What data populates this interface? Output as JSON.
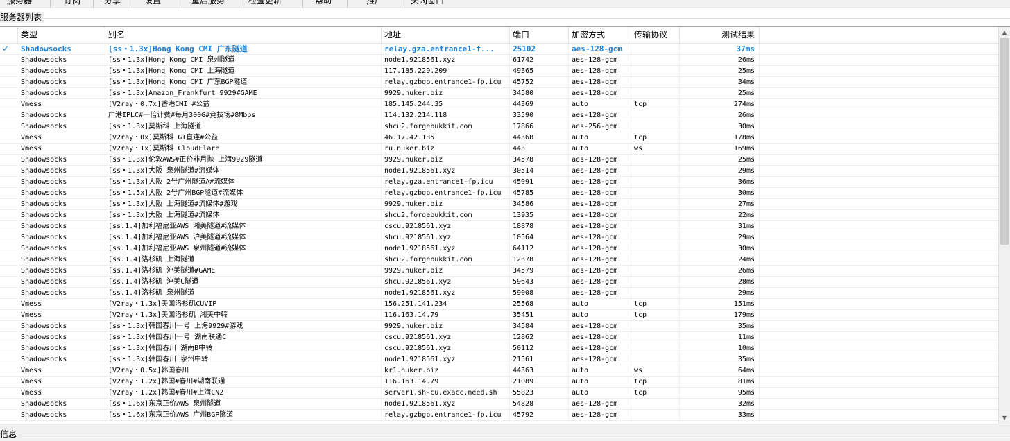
{
  "menu": {
    "items": [
      "服务器",
      "订阅",
      "分享",
      "设置",
      "重启服务",
      "检查更新",
      "帮助",
      "推广",
      "关闭窗口"
    ]
  },
  "server_list": {
    "title": "服务器列表",
    "columns": {
      "type": "类型",
      "alias": "别名",
      "address": "地址",
      "port": "端口",
      "encryption": "加密方式",
      "protocol": "传输协议",
      "test_result": "测试结果"
    },
    "active_marker": "✓",
    "rows": [
      {
        "type": "Shadowsocks",
        "alias": "[ss・1.3x]Hong Kong CMI 广东隧道",
        "address": "relay.gza.entrance1-f...",
        "port": "25102",
        "encryption": "aes-128-gcm",
        "protocol": "",
        "result": "37ms",
        "active": true
      },
      {
        "type": "Shadowsocks",
        "alias": "[ss・1.3x]Hong Kong CMI 泉州隧道",
        "address": "node1.9218561.xyz",
        "port": "61742",
        "encryption": "aes-128-gcm",
        "protocol": "",
        "result": "26ms"
      },
      {
        "type": "Shadowsocks",
        "alias": "[ss・1.3x]Hong Kong CMI 上海隧道",
        "address": "117.185.229.209",
        "port": "49365",
        "encryption": "aes-128-gcm",
        "protocol": "",
        "result": "25ms"
      },
      {
        "type": "Shadowsocks",
        "alias": "[ss・1.3x]Hong Kong CMI 广东BGP隧道",
        "address": "relay.gzbgp.entrance1-fp.icu",
        "port": "45752",
        "encryption": "aes-128-gcm",
        "protocol": "",
        "result": "34ms"
      },
      {
        "type": "Shadowsocks",
        "alias": "[ss・1.3x]Amazon_Frankfurt 9929#GAME",
        "address": "9929.nuker.biz",
        "port": "34580",
        "encryption": "aes-128-gcm",
        "protocol": "",
        "result": "25ms"
      },
      {
        "type": "Vmess",
        "alias": "[V2ray・0.7x]香港CMI #公益",
        "address": "185.145.244.35",
        "port": "44369",
        "encryption": "auto",
        "protocol": "tcp",
        "result": "274ms"
      },
      {
        "type": "Shadowsocks",
        "alias": "广港IPLC#一倍计费#每月300G#竞技场#8Mbps",
        "address": "114.132.214.118",
        "port": "33590",
        "encryption": "aes-128-gcm",
        "protocol": "",
        "result": "26ms"
      },
      {
        "type": "Shadowsocks",
        "alias": "[ss・1.3x]莫斯科 上海隧道",
        "address": "shcu2.forgebukkit.com",
        "port": "17866",
        "encryption": "aes-256-gcm",
        "protocol": "",
        "result": "30ms"
      },
      {
        "type": "Vmess",
        "alias": "[V2ray・0x]莫斯科 GT直连#公益",
        "address": "46.17.42.135",
        "port": "44368",
        "encryption": "auto",
        "protocol": "tcp",
        "result": "178ms"
      },
      {
        "type": "Vmess",
        "alias": "[V2ray・1x]莫斯科 CloudFlare",
        "address": "ru.nuker.biz",
        "port": "443",
        "encryption": "auto",
        "protocol": "ws",
        "result": "169ms"
      },
      {
        "type": "Shadowsocks",
        "alias": "[ss・1.3x]伦敦AWS#正价非月抛 上海9929隧道",
        "address": "9929.nuker.biz",
        "port": "34578",
        "encryption": "aes-128-gcm",
        "protocol": "",
        "result": "25ms"
      },
      {
        "type": "Shadowsocks",
        "alias": "[ss・1.3x]大阪 泉州隧道#流媒体",
        "address": "node1.9218561.xyz",
        "port": "30514",
        "encryption": "aes-128-gcm",
        "protocol": "",
        "result": "29ms"
      },
      {
        "type": "Shadowsocks",
        "alias": "[ss・1.3x]大阪 2号广州隧道A#流媒体",
        "address": "relay.gza.entrance1-fp.icu",
        "port": "45091",
        "encryption": "aes-128-gcm",
        "protocol": "",
        "result": "36ms"
      },
      {
        "type": "Shadowsocks",
        "alias": "[ss・1.5x]大阪 2号广州BGP隧道#流媒体",
        "address": "relay.gzbgp.entrance1-fp.icu",
        "port": "45785",
        "encryption": "aes-128-gcm",
        "protocol": "",
        "result": "30ms"
      },
      {
        "type": "Shadowsocks",
        "alias": "[ss・1.3x]大阪 上海隧道#流媒体#游戏",
        "address": "9929.nuker.biz",
        "port": "34586",
        "encryption": "aes-128-gcm",
        "protocol": "",
        "result": "27ms"
      },
      {
        "type": "Shadowsocks",
        "alias": "[ss・1.3x]大阪 上海隧道#流媒体",
        "address": "shcu2.forgebukkit.com",
        "port": "13935",
        "encryption": "aes-128-gcm",
        "protocol": "",
        "result": "22ms"
      },
      {
        "type": "Shadowsocks",
        "alias": "[ss.1.4]加利福尼亚AWS 湘美隧道#流媒体",
        "address": "cscu.9218561.xyz",
        "port": "18878",
        "encryption": "aes-128-gcm",
        "protocol": "",
        "result": "31ms"
      },
      {
        "type": "Shadowsocks",
        "alias": "[ss.1.4]加利福尼亚AWS 沪美隧道#流媒体",
        "address": "shcu.9218561.xyz",
        "port": "10564",
        "encryption": "aes-128-gcm",
        "protocol": "",
        "result": "29ms"
      },
      {
        "type": "Shadowsocks",
        "alias": "[ss.1.4]加利福尼亚AWS 泉州隧道#流媒体",
        "address": "node1.9218561.xyz",
        "port": "64112",
        "encryption": "aes-128-gcm",
        "protocol": "",
        "result": "30ms"
      },
      {
        "type": "Shadowsocks",
        "alias": "[ss.1.4]洛杉矶 上海隧道",
        "address": "shcu2.forgebukkit.com",
        "port": "12378",
        "encryption": "aes-128-gcm",
        "protocol": "",
        "result": "24ms"
      },
      {
        "type": "Shadowsocks",
        "alias": "[ss.1.4]洛杉矶 沪美隧道#GAME",
        "address": "9929.nuker.biz",
        "port": "34579",
        "encryption": "aes-128-gcm",
        "protocol": "",
        "result": "26ms"
      },
      {
        "type": "Shadowsocks",
        "alias": "[ss.1.4]洛杉矶 沪美C隧道",
        "address": "shcu.9218561.xyz",
        "port": "59643",
        "encryption": "aes-128-gcm",
        "protocol": "",
        "result": "28ms"
      },
      {
        "type": "Shadowsocks",
        "alias": "[ss.1.4]洛杉矶 泉州隧道",
        "address": "node1.9218561.xyz",
        "port": "59008",
        "encryption": "aes-128-gcm",
        "protocol": "",
        "result": "29ms"
      },
      {
        "type": "Vmess",
        "alias": "[V2ray・1.3x]美国洛杉矶CUVIP",
        "address": "156.251.141.234",
        "port": "25568",
        "encryption": "auto",
        "protocol": "tcp",
        "result": "151ms"
      },
      {
        "type": "Vmess",
        "alias": "[V2ray・1.3x]美国洛杉矶 湘美中转",
        "address": "116.163.14.79",
        "port": "35451",
        "encryption": "auto",
        "protocol": "tcp",
        "result": "179ms"
      },
      {
        "type": "Shadowsocks",
        "alias": "[ss・1.3x]韩国春川一号 上海9929#游戏",
        "address": "9929.nuker.biz",
        "port": "34584",
        "encryption": "aes-128-gcm",
        "protocol": "",
        "result": "35ms"
      },
      {
        "type": "Shadowsocks",
        "alias": "[ss・1.3x]韩国春川一号 湖南联通C",
        "address": "cscu.9218561.xyz",
        "port": "12862",
        "encryption": "aes-128-gcm",
        "protocol": "",
        "result": "11ms"
      },
      {
        "type": "Shadowsocks",
        "alias": "[ss・1.3x]韩国春川 湖南B中转",
        "address": "cscu.9218561.xyz",
        "port": "50112",
        "encryption": "aes-128-gcm",
        "protocol": "",
        "result": "10ms"
      },
      {
        "type": "Shadowsocks",
        "alias": "[ss・1.3x]韩国春川 泉州中转",
        "address": "node1.9218561.xyz",
        "port": "21561",
        "encryption": "aes-128-gcm",
        "protocol": "",
        "result": "35ms"
      },
      {
        "type": "Vmess",
        "alias": "[V2ray・0.5x]韩国春川",
        "address": "kr1.nuker.biz",
        "port": "44363",
        "encryption": "auto",
        "protocol": "ws",
        "result": "64ms"
      },
      {
        "type": "Vmess",
        "alias": "[V2ray・1.2x]韩国#春川#湖南联通",
        "address": "116.163.14.79",
        "port": "21089",
        "encryption": "auto",
        "protocol": "tcp",
        "result": "81ms"
      },
      {
        "type": "Vmess",
        "alias": "[V2ray・1.2x]韩国#春川#上海CN2",
        "address": "server1.sh-cu.exacc.need.sh",
        "port": "55823",
        "encryption": "auto",
        "protocol": "tcp",
        "result": "95ms"
      },
      {
        "type": "Shadowsocks",
        "alias": "[ss・1.6x]东京正价AWS 泉州隧道",
        "address": "node1.9218561.xyz",
        "port": "54828",
        "encryption": "aes-128-gcm",
        "protocol": "",
        "result": "32ms"
      },
      {
        "type": "Shadowsocks",
        "alias": "[ss・1.6x]东京正价AWS 广州BGP隧道",
        "address": "relay.gzbgp.entrance1-fp.icu",
        "port": "45792",
        "encryption": "aes-128-gcm",
        "protocol": "",
        "result": "33ms"
      }
    ]
  },
  "status": {
    "label": "信息"
  }
}
